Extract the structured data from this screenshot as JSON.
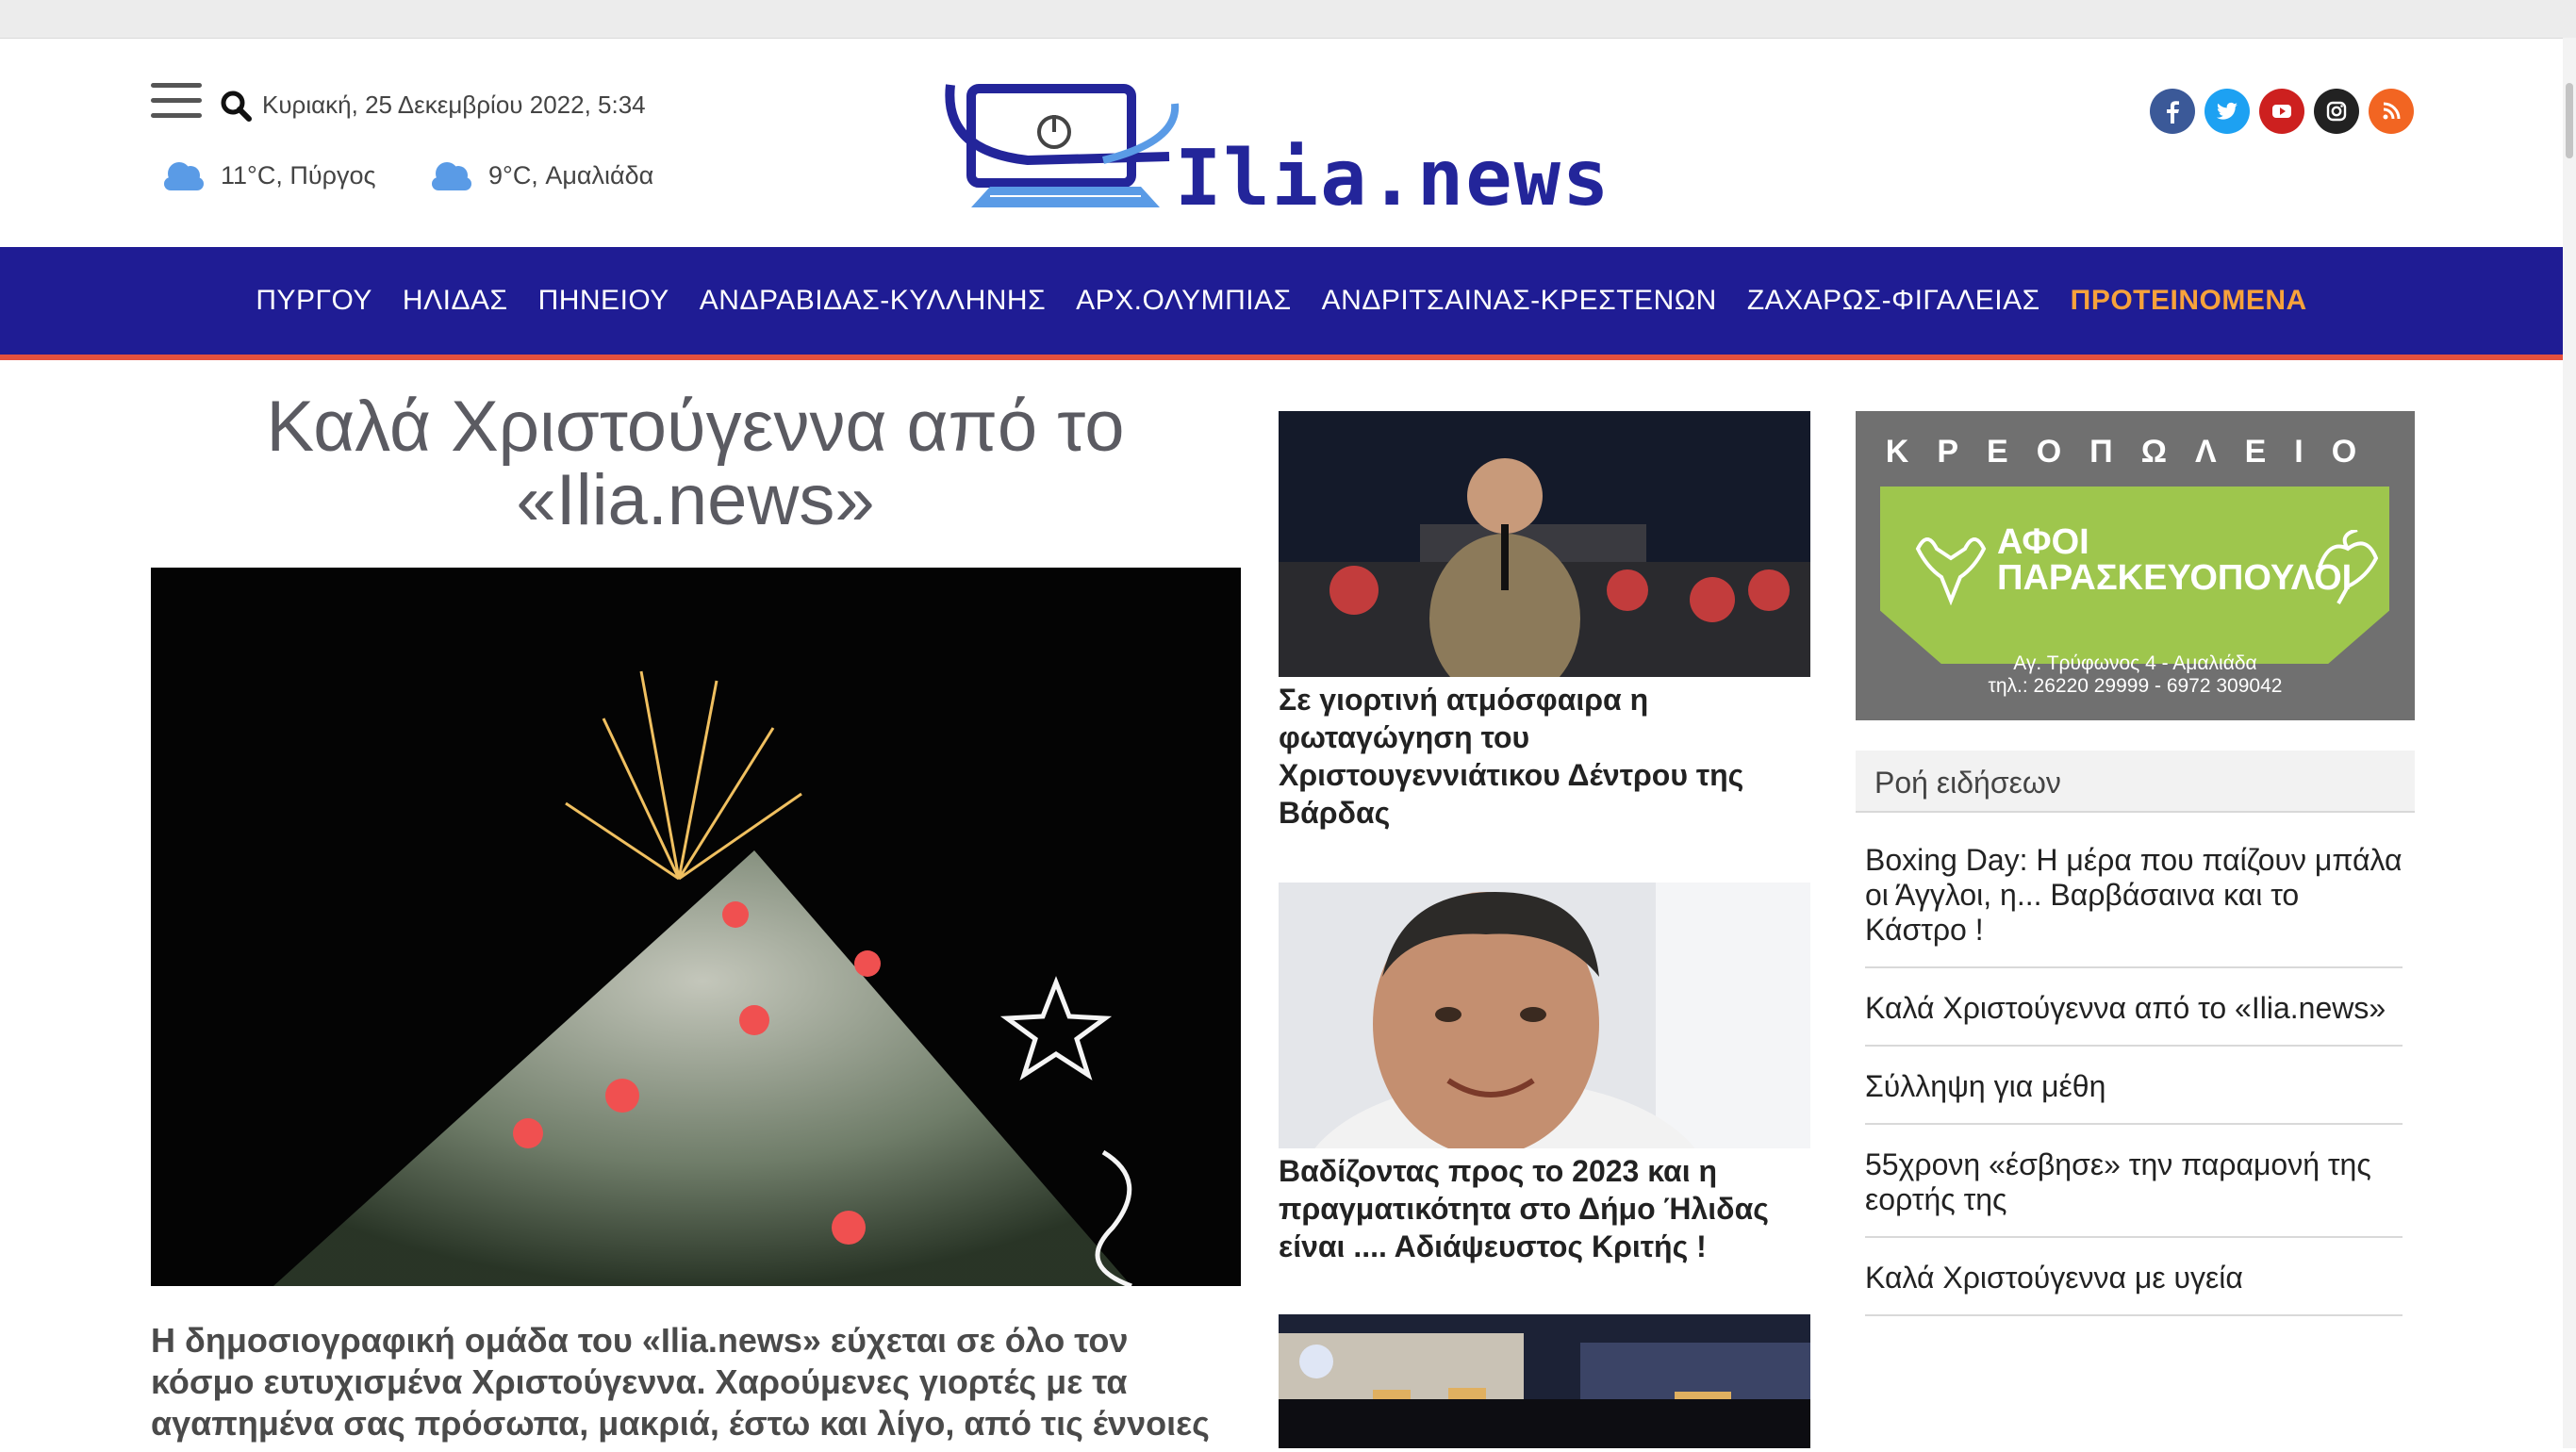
{
  "header": {
    "date": "Κυριακή, 25 Δεκεμβρίου 2022, 5:34",
    "weather": [
      {
        "temp_place": "11°C, Πύργος",
        "icon": "cloud-icon"
      },
      {
        "temp_place": "9°C, Αμαλιάδα",
        "icon": "cloud-icon"
      }
    ],
    "logo_text": "Ilia.news",
    "socials": [
      {
        "name": "facebook-icon",
        "color": "#3b5998"
      },
      {
        "name": "twitter-icon",
        "color": "#1da1f2"
      },
      {
        "name": "youtube-icon",
        "color": "#cd201f"
      },
      {
        "name": "instagram-icon",
        "color": "#222222"
      },
      {
        "name": "rss-icon",
        "color": "#f26522"
      }
    ]
  },
  "nav": {
    "items": [
      "ΠΥΡΓΟΥ",
      "ΗΛΙΔΑΣ",
      "ΠΗΝΕΙΟΥ",
      "ΑΝΔΡΑΒΙΔΑΣ-ΚΥΛΛΗΝΗΣ",
      "ΑΡΧ.ΟΛΥΜΠΙΑΣ",
      "ΑΝΔΡΙΤΣΑΙΝΑΣ-ΚΡΕΣΤΕΝΩΝ",
      "ΖΑΧΑΡΩΣ-ΦΙΓΑΛΕΙΑΣ",
      "ΠΡΟΤΕΙΝΟΜΕΝΑ"
    ],
    "bg_color": "#1f1c94",
    "highlight_color": "#f7a23b"
  },
  "main_article": {
    "title": "Καλά Χριστούγεννα από το «Ilia.news»",
    "excerpt": "Η δημοσιογραφική ομάδα του «Ilia.news» εύχεται σε όλο τον κόσμο ευτυχισμένα Χριστούγεννα. Χαρούμενες γιορτές με τα αγαπημένα σας πρόσωπα, μακριά, έστω και λίγο, από τις έννοιες"
  },
  "side_articles": [
    {
      "title": "Σε γιορτινή ατμόσφαιρα η φωταγώγηση του Χριστουγεννιάτικου Δέντρου της Βάρδας"
    },
    {
      "title": "Βαδίζοντας προς το 2023 και η πραγματικότητα στο Δήμο Ήλιδας είναι .... Αδιάψευστος Κριτής !"
    },
    {
      "title": ""
    }
  ],
  "ad": {
    "top": "ΚΡΕΟΠΩΛΕΙΟ",
    "name_line1": "ΑΦΟΙ",
    "name_line2": "ΠΑΡΑΣΚΕΥΟΠΟΥΛΟΙ",
    "address": "Αγ. Τρύφωνος 4 - Αμαλιάδα",
    "phone": "τηλ.: 26220 29999 - 6972 309042"
  },
  "news_feed": {
    "header": "Ροή ειδήσεων",
    "items": [
      "Boxing Day: Η μέρα που παίζουν μπάλα οι Άγγλοι, η... Βαρβάσαινα και το Κάστρο !",
      "Καλά Χριστούγεννα από το «Ilia.news»",
      "Σύλληψη για μέθη",
      "55χρονη «έσβησε» την παραμονή της εορτής της",
      "Καλά Χριστούγεννα με υγεία"
    ]
  }
}
